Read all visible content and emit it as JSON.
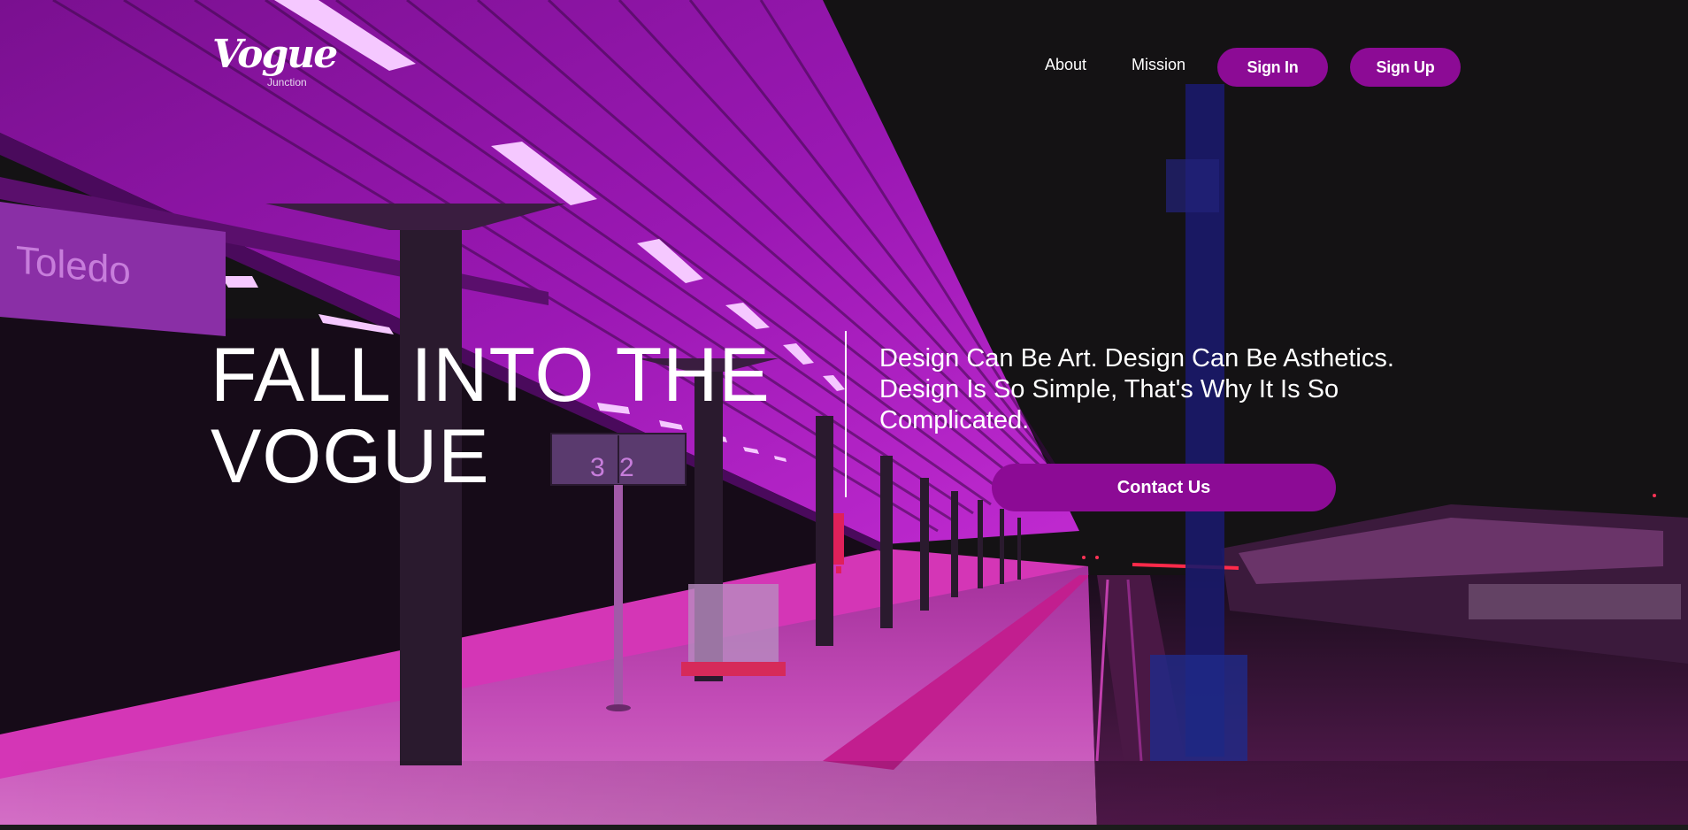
{
  "brand": {
    "logo_script": "Vogue",
    "logo_sub": "Junction"
  },
  "nav": {
    "links": [
      "About",
      "Mission"
    ],
    "sign_in_label": "Sign In",
    "sign_up_label": "Sign Up"
  },
  "hero": {
    "headline": "FALL INTO THE VOGUE",
    "tagline": "Design Can Be Art. Design Can Be Asthetics. Design Is So Simple, That's Why It Is So Complicated.",
    "cta_label": "Contact Us",
    "background_sign": "Toledo",
    "platform_numbers": "3 2"
  },
  "colors": {
    "accent": "#8c0b95",
    "neon": "#c21fd6",
    "background": "#141214",
    "text": "#ffffff"
  },
  "icons": [
    "logo-icon"
  ]
}
